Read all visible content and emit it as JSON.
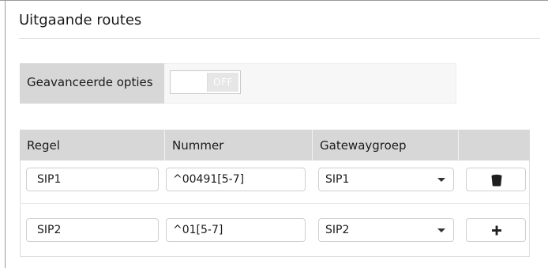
{
  "page": {
    "title": "Uitgaande routes"
  },
  "advanced": {
    "label": "Geavanceerde opties",
    "toggle_state": "OFF",
    "enabled": false
  },
  "table": {
    "headers": {
      "rule": "Regel",
      "number": "Nummer",
      "gateway_group": "Gatewaygroep"
    },
    "rows": [
      {
        "rule": "SIP1",
        "number": "^00491[5-7]",
        "gateway_group": "SIP1",
        "action_icon": "trash-icon"
      },
      {
        "rule": "SIP2",
        "number": "^01[5-7]",
        "gateway_group": "SIP2",
        "action_icon": "plus-icon"
      }
    ]
  }
}
